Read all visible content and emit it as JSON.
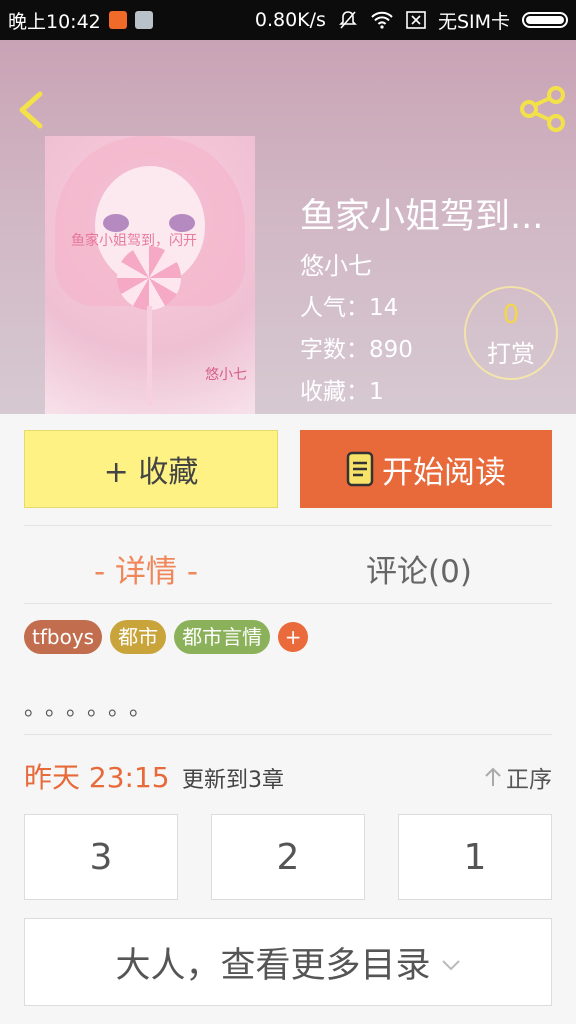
{
  "status_bar": {
    "time": "晚上10:42",
    "speed": "0.80K/s",
    "sim": "无SIM卡"
  },
  "book": {
    "title": "鱼家小姐驾到...",
    "author": "悠小七",
    "cover_text": "鱼家小姐驾到，闪开",
    "cover_signature": "悠小七",
    "stats": [
      {
        "label": "人气：14"
      },
      {
        "label": "字数：890"
      },
      {
        "label": "收藏：1"
      }
    ],
    "tip": {
      "count": "0",
      "label": "打赏"
    }
  },
  "actions": {
    "favorite_label": "+ 收藏",
    "read_label": "开始阅读"
  },
  "tabs": [
    {
      "label": "- 详情 -",
      "active": true
    },
    {
      "label": "评论(0)",
      "active": false
    }
  ],
  "tags": [
    {
      "label": "tfboys",
      "color": "#c16d4e"
    },
    {
      "label": "都市",
      "color": "#c8a43a"
    },
    {
      "label": "都市言情",
      "color": "#8bb25a"
    }
  ],
  "tag_add_label": "+",
  "description": "。。。。。。",
  "update": {
    "time": "昨天 23:15",
    "text": "更新到3章",
    "sort_label": "正序"
  },
  "chapters": [
    "3",
    "2",
    "1"
  ],
  "more_label": "大人，查看更多目录",
  "colors": {
    "accent": "#e8693a",
    "favorite_bg": "#fdf283",
    "tab_active": "#f0865a"
  }
}
